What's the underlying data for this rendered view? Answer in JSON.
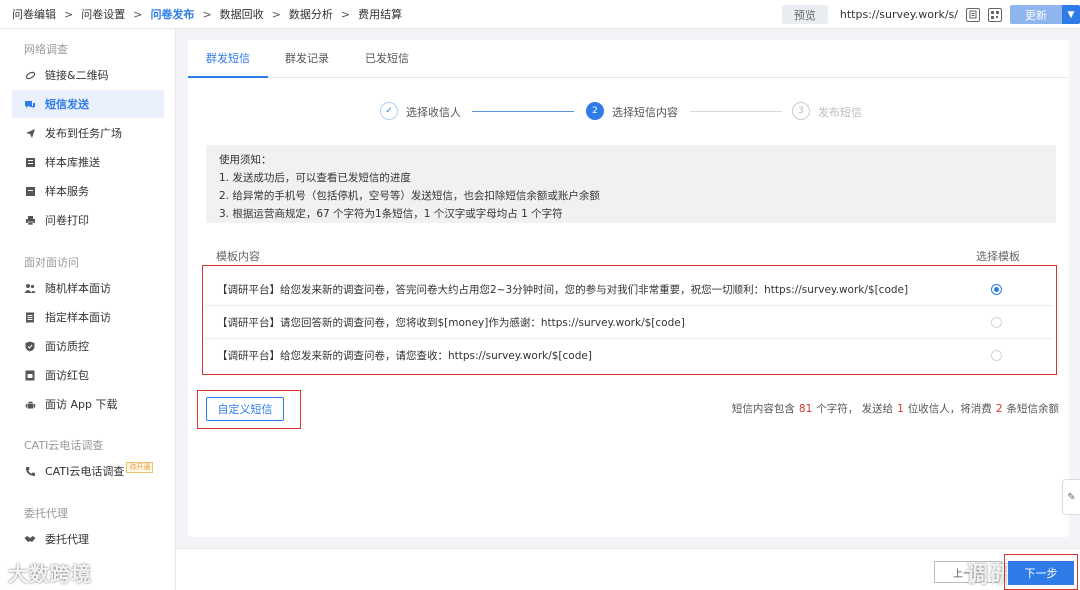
{
  "breadcrumb": {
    "items": [
      "问卷编辑",
      "问卷设置",
      "问卷发布",
      "数据回收",
      "数据分析",
      "费用结算"
    ],
    "separator": ">"
  },
  "topbar": {
    "preview_label": "预览",
    "url": "https://survey.work/s/",
    "update_label": "更新",
    "caret": "▼"
  },
  "sidebar": {
    "groups": {
      "network": "网络调查",
      "face": "面对面访问",
      "cati": "CATI云电话调查",
      "agent": "委托代理"
    },
    "items": {
      "link_qr": "链接&二维码",
      "sms": "短信发送",
      "task_square": "发布到任务广场",
      "sample_push": "样本库推送",
      "sample_service": "样本服务",
      "print": "问卷打印",
      "random_interview": "随机样本面访",
      "assigned_interview": "指定样本面访",
      "interview_qc": "面访质控",
      "interview_redpacket": "面访红包",
      "interview_app": "面访 App 下载",
      "cati": "CATI云电话调查",
      "cati_tag": "待开通",
      "agent": "委托代理"
    }
  },
  "tabs": [
    "群发短信",
    "群发记录",
    "已发短信"
  ],
  "steps": [
    {
      "num": "✓",
      "label": "选择收信人"
    },
    {
      "num": "2",
      "label": "选择短信内容"
    },
    {
      "num": "3",
      "label": "发布短信"
    }
  ],
  "notice": {
    "title": "使用须知：",
    "lines": [
      "1. 发送成功后，可以查看已发短信的进度",
      "2. 给异常的手机号（包括停机，空号等）发送短信，也会扣除短信余额或账户余额",
      "3. 根据运营商规定，67 个字符为1条短信，1 个汉字或字母均占 1 个字符"
    ]
  },
  "templates": {
    "header": "模板内容",
    "select_header": "选择模板",
    "rows": [
      "【调研平台】给您发来新的调查问卷，答完问卷大约占用您2~3分钟时间，您的参与对我们非常重要，祝您一切顺利：https://survey.work/$[code]",
      "【调研平台】请您回答新的调查问卷，您将收到$[money]作为感谢：https://survey.work/$[code]",
      "【调研平台】给您发来新的调查问卷，请您查收：https://survey.work/$[code]"
    ],
    "selected_index": 0
  },
  "custom_sms_label": "自定义短信",
  "summary": {
    "prefix": "短信内容包含",
    "char_count": "81",
    "mid1": "个字符，  发送给",
    "recipients": "1",
    "mid2": "位收信人，将消费",
    "sms_count": "2",
    "suffix": "条短信余额"
  },
  "footer": {
    "prev_label": "上一步",
    "next_label": "下一步",
    "watermark": "调研"
  },
  "bottom_left_watermark": "大数跨境",
  "float_tab_icon": "✎"
}
